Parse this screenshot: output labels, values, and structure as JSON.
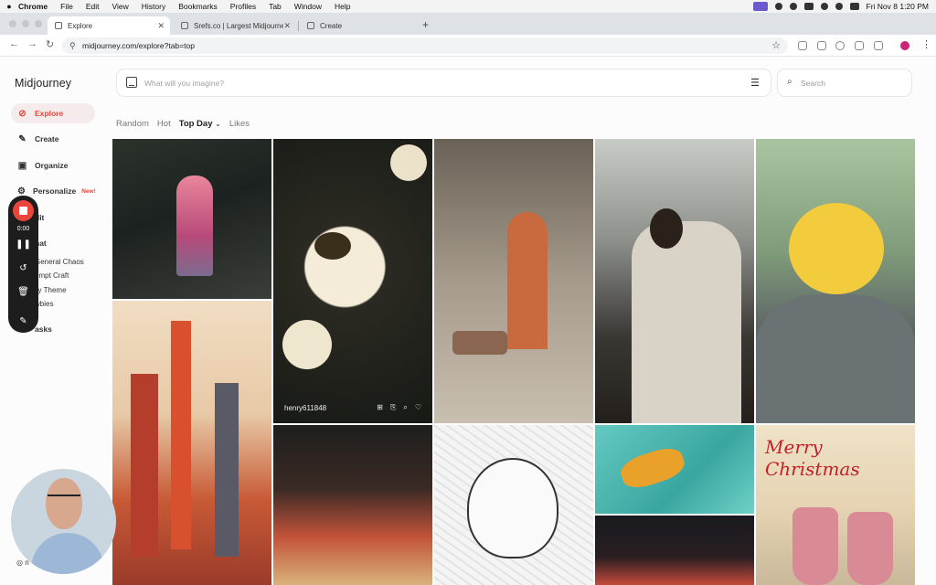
{
  "menubar": {
    "apple": "",
    "items": [
      "Chrome",
      "File",
      "Edit",
      "View",
      "History",
      "Bookmarks",
      "Profiles",
      "Tab",
      "Window",
      "Help"
    ],
    "datetime": "Fri Nov 8  1:20 PM"
  },
  "tabs": [
    {
      "title": "Explore"
    },
    {
      "title": "Srefs.co | Largest Midjourney"
    },
    {
      "title": "Create"
    }
  ],
  "toolbar": {
    "url": "midjourney.com/explore?tab=top"
  },
  "sidebar": {
    "logo": "Midjourney",
    "items": [
      {
        "label": "Explore",
        "icon": "compass-icon"
      },
      {
        "label": "Create",
        "icon": "brush-icon"
      },
      {
        "label": "Organize",
        "icon": "image-icon"
      },
      {
        "label": "Personalize",
        "icon": "sliders-icon",
        "badge": "New!"
      },
      {
        "label": "dit",
        "icon": "edit-icon"
      },
      {
        "label": "hat",
        "icon": "chat-icon"
      },
      {
        "label": "asks",
        "icon": "tasks-icon"
      }
    ],
    "channels": [
      "General Chaos",
      "ompt Craft",
      "ily Theme",
      "wbies"
    ],
    "user_initial": "n"
  },
  "prompt": {
    "placeholder": "What will you imagine?"
  },
  "search": {
    "placeholder": "Search"
  },
  "filters": [
    "Random",
    "Hot",
    "Top Day",
    "Likes"
  ],
  "selected_filter": "Top Day",
  "grid": {
    "hover_user": "henry611848",
    "card_caption": "Merry Christmas",
    "actions": [
      "⊞",
      "⎘",
      "⌕",
      "♡"
    ]
  },
  "recorder": {
    "time": "0:00"
  },
  "colors": {
    "accent": "#e8453c",
    "active_bg": "#f5ebeb"
  }
}
